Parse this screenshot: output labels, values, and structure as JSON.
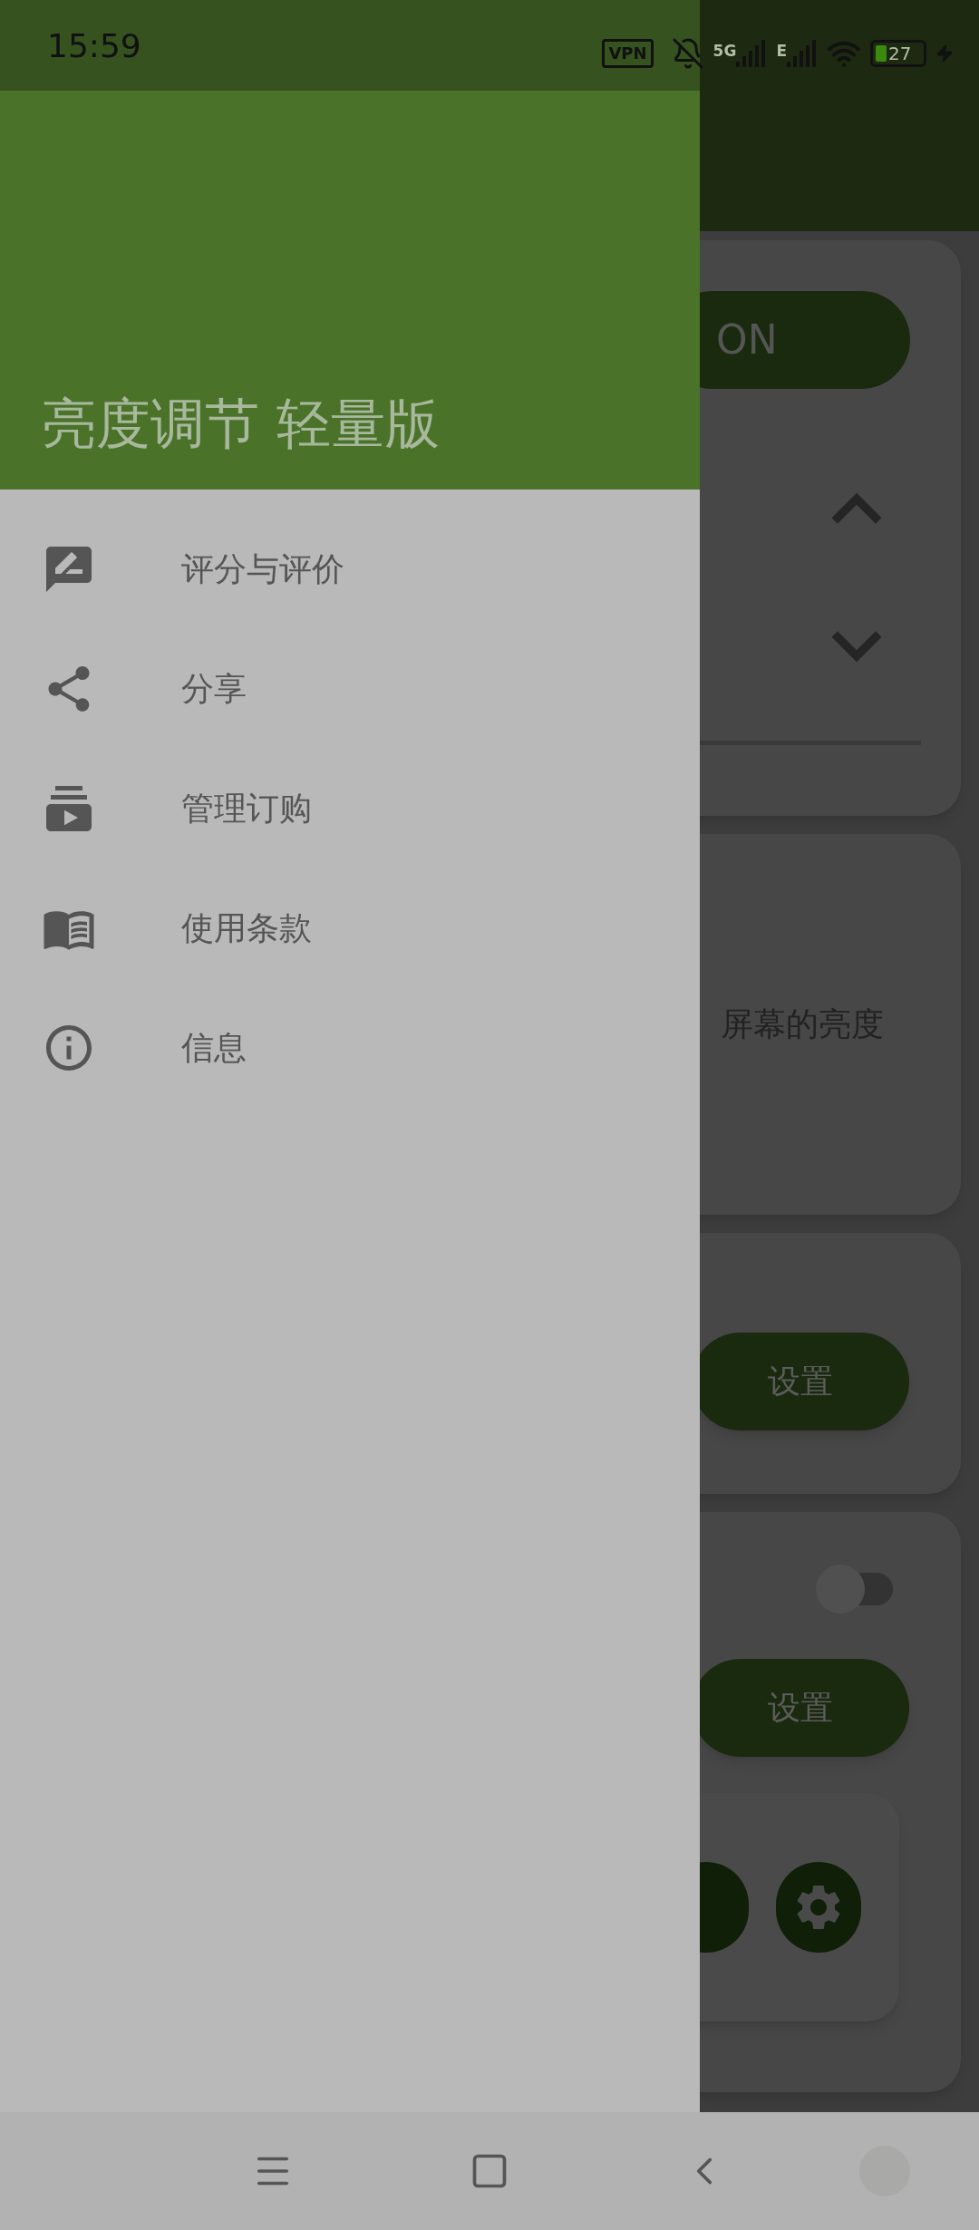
{
  "status_bar": {
    "time": "15:59",
    "vpn": "VPN",
    "network_1": "5G",
    "network_2": "E",
    "battery": "27"
  },
  "drawer": {
    "title": "亮度调节 轻量版",
    "items": [
      {
        "label": "评分与评价"
      },
      {
        "label": "分享"
      },
      {
        "label": "管理订购"
      },
      {
        "label": "使用条款"
      },
      {
        "label": "信息"
      }
    ]
  },
  "background": {
    "power_button": "ON",
    "description": "屏幕的亮度",
    "settings_buttons": [
      "设置",
      "设置"
    ],
    "toggle": {
      "on": false
    }
  }
}
